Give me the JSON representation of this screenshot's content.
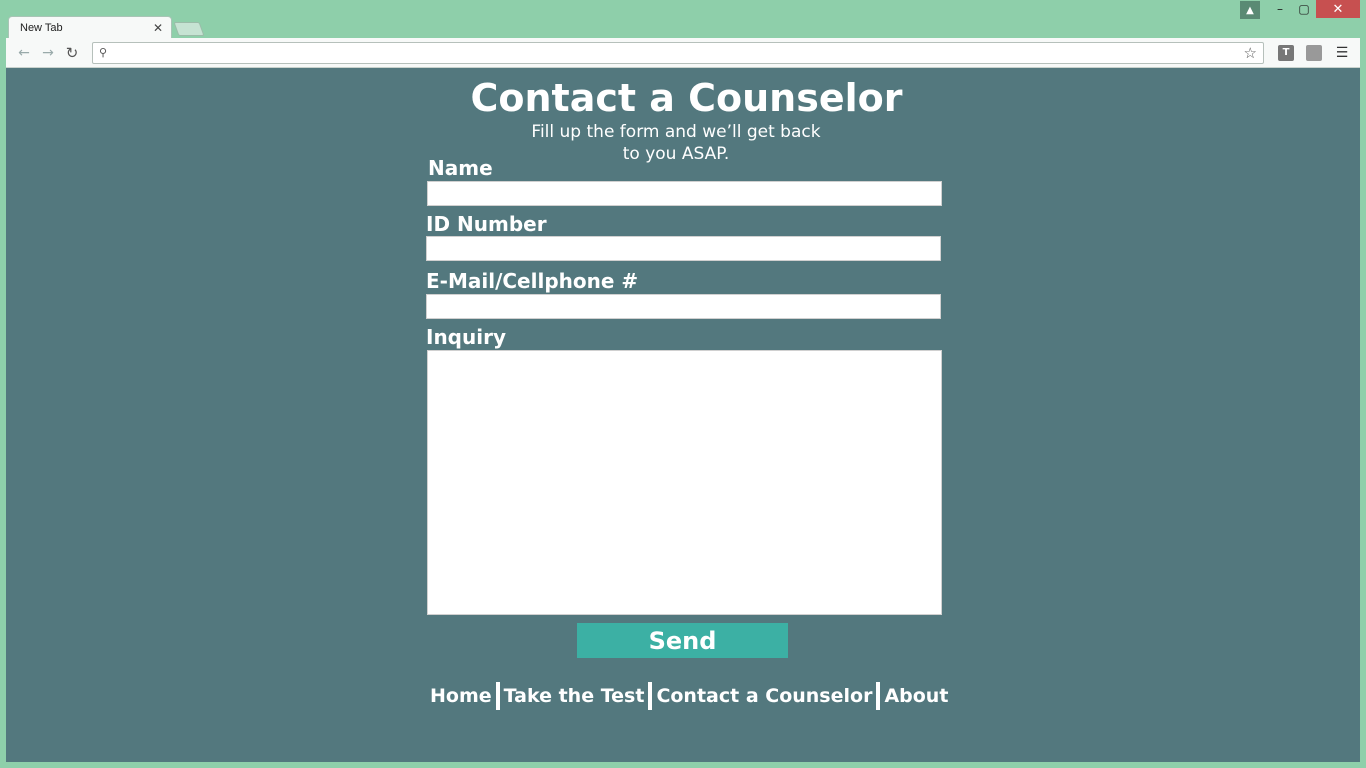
{
  "browser": {
    "tab_title": "New Tab",
    "tab_close": "✕",
    "omnibox_value": "",
    "ext_1_label": "T",
    "ext_2_label": ""
  },
  "window": {
    "minimize": "–",
    "maximize": "▢",
    "close": "✕"
  },
  "page": {
    "title": "Contact a Counselor",
    "subtitle_line1": "Fill up the form and we’ll get back",
    "subtitle_line2": "to you ASAP.",
    "form": {
      "name_label": "Name",
      "name_value": "",
      "id_label": "ID Number",
      "id_value": "",
      "contact_label": "E-Mail/Cellphone #",
      "contact_value": "",
      "inquiry_label": "Inquiry",
      "inquiry_value": "",
      "send_label": "Send"
    },
    "footer_nav": [
      {
        "label": "Home"
      },
      {
        "label": "Take the Test"
      },
      {
        "label": "Contact a Counselor"
      },
      {
        "label": "About"
      }
    ]
  },
  "colors": {
    "window_frame": "#8ecfaa",
    "page_background": "#53787e",
    "send_button": "#3cb0a4",
    "close_button": "#c75050"
  }
}
